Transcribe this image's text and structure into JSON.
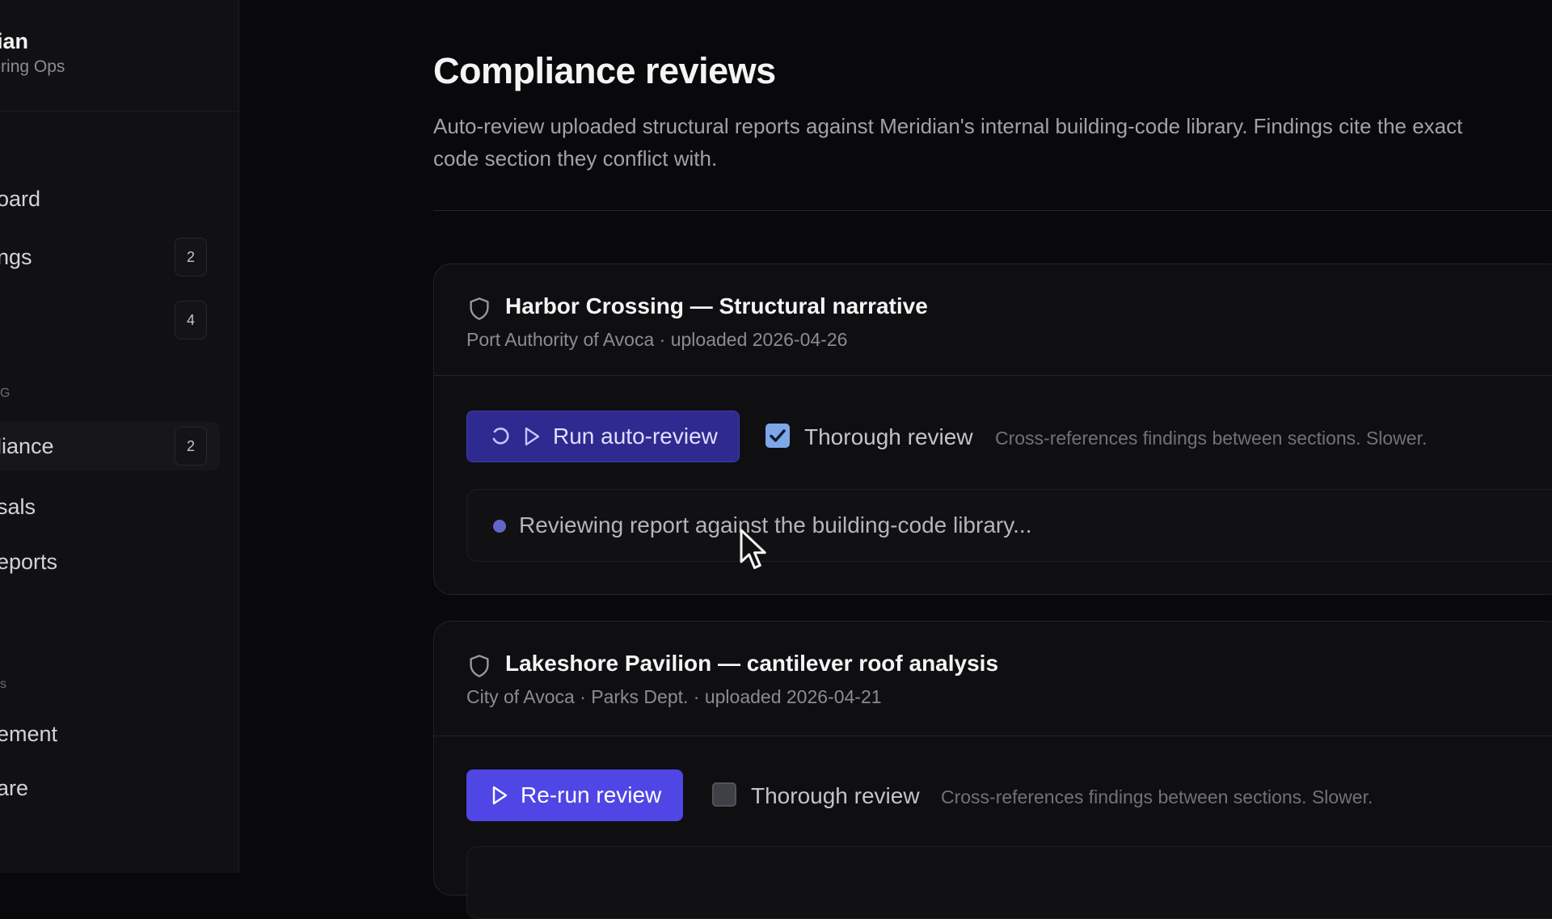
{
  "sidebar": {
    "brand": {
      "name": "idian",
      "subtitle": "neering Ops"
    },
    "items": [
      {
        "label": "oard",
        "badge": ""
      },
      {
        "label": "ngs",
        "badge": "2"
      },
      {
        "label": "",
        "badge": "4"
      },
      {
        "label": "liance",
        "badge": "2"
      },
      {
        "label": "sals",
        "badge": ""
      },
      {
        "label": "eports",
        "badge": ""
      },
      {
        "label": "ement",
        "badge": ""
      },
      {
        "label": "are",
        "badge": ""
      }
    ],
    "sections": [
      "G",
      "s"
    ]
  },
  "main": {
    "title": "Compliance reviews",
    "description": "Auto-review uploaded structural reports against Meridian's internal building-code library. Findings cite the exact code section they conflict with."
  },
  "cards": [
    {
      "title": "Harbor Crossing — Structural narrative",
      "meta": "Port Authority of Avoca · uploaded 2026-04-26",
      "button_label": "Run auto-review",
      "thorough_label": "Thorough review",
      "thorough_checked": true,
      "hint": "Cross-references findings between sections. Slower.",
      "status": "Reviewing report against the building-code library..."
    },
    {
      "title": "Lakeshore Pavilion — cantilever roof analysis",
      "meta": "City of Avoca · Parks Dept. · uploaded 2026-04-21",
      "button_label": "Re-run review",
      "thorough_label": "Thorough review",
      "thorough_checked": false,
      "hint": "Cross-references findings between sections. Slower."
    }
  ],
  "colors": {
    "accent": "#4f46e5",
    "accent_running": "#2e2a8f",
    "checkbox_on": "#7da7e8",
    "background": "#09090b"
  }
}
